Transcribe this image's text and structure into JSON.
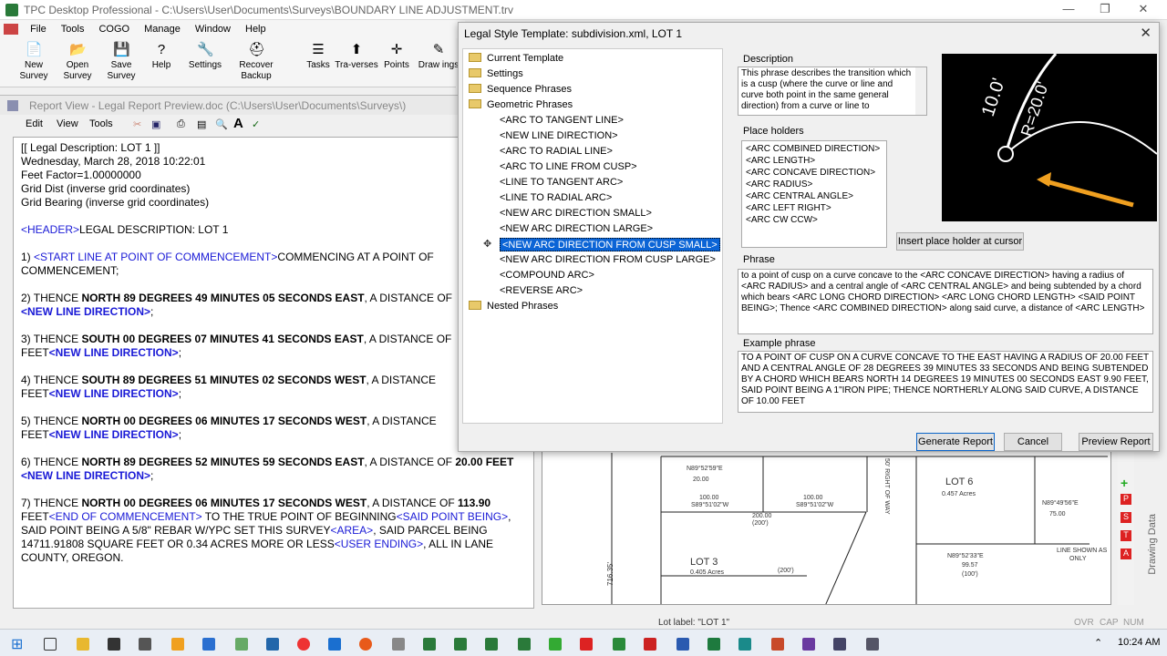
{
  "app": {
    "title": "TPC Desktop Professional - C:\\Users\\User\\Documents\\Surveys\\BOUNDARY LINE ADJUSTMENT.trv",
    "window_controls": [
      "—",
      "❐",
      "✕"
    ]
  },
  "menu": [
    "File",
    "Tools",
    "COGO",
    "Manage",
    "Window",
    "Help"
  ],
  "toolbar": [
    {
      "label": "New Survey",
      "icon": "new-survey-icon",
      "glyph": "📄"
    },
    {
      "label": "Open Survey",
      "icon": "open-survey-icon",
      "glyph": "📂"
    },
    {
      "label": "Save Survey",
      "icon": "save-survey-icon",
      "glyph": "💾"
    },
    {
      "label": "Help",
      "icon": "help-icon",
      "glyph": "?"
    },
    {
      "label": "Settings",
      "icon": "settings-icon",
      "glyph": "🔧"
    },
    {
      "label": "Recover Backup",
      "icon": "recover-backup-icon",
      "glyph": "⛑"
    },
    {
      "label": "Tasks",
      "icon": "tasks-icon",
      "glyph": "☰"
    },
    {
      "label": "Tra-verses",
      "icon": "traverses-icon",
      "glyph": "⬆"
    },
    {
      "label": "Points",
      "icon": "points-icon",
      "glyph": "✛"
    },
    {
      "label": "Draw ings",
      "icon": "drawings-icon",
      "glyph": "✎"
    }
  ],
  "report_view": {
    "title": "Report View - Legal Report Preview.doc (C:\\Users\\User\\Documents\\Surveys\\)",
    "menu": [
      "Edit",
      "View",
      "Tools"
    ],
    "lines": [
      [
        {
          "t": "[[ Legal Description: LOT 1 ]]"
        }
      ],
      [
        {
          "t": "Wednesday, March 28, 2018 10:22:01"
        }
      ],
      [
        {
          "t": "Feet  Factor=1.00000000"
        }
      ],
      [
        {
          "t": "Grid Dist (inverse grid coordinates)"
        }
      ],
      [
        {
          "t": "Grid Bearing (inverse grid coordinates)"
        }
      ],
      [
        {
          "t": ""
        }
      ],
      [
        {
          "t": "<HEADER>",
          "c": "b"
        },
        {
          "t": "LEGAL DESCRIPTION: LOT 1"
        }
      ],
      [
        {
          "t": ""
        }
      ],
      [
        {
          "t": "1) "
        },
        {
          "t": "<START LINE AT POINT OF COMMENCEMENT>",
          "c": "b"
        },
        {
          "t": "COMMENCING AT A POINT OF"
        }
      ],
      [
        {
          "t": "COMMENCEMENT;"
        }
      ],
      [
        {
          "t": ""
        }
      ],
      [
        {
          "t": "2) THENCE "
        },
        {
          "t": "NORTH  89 DEGREES  49 MINUTES  05 SECONDS  EAST",
          "c": "k"
        },
        {
          "t": ", A DISTANCE OF"
        }
      ],
      [
        {
          "t": "<NEW LINE DIRECTION>",
          "c": "b k"
        },
        {
          "t": ";"
        }
      ],
      [
        {
          "t": ""
        }
      ],
      [
        {
          "t": "3) THENCE "
        },
        {
          "t": "SOUTH  00 DEGREES  07 MINUTES  41 SECONDS  EAST",
          "c": "k"
        },
        {
          "t": ", A DISTANCE OF"
        }
      ],
      [
        {
          "t": "FEET"
        },
        {
          "t": "<NEW LINE DIRECTION>",
          "c": "b k"
        },
        {
          "t": ";"
        }
      ],
      [
        {
          "t": ""
        }
      ],
      [
        {
          "t": "4) THENCE "
        },
        {
          "t": "SOUTH  89 DEGREES  51 MINUTES  02 SECONDS  WEST",
          "c": "k"
        },
        {
          "t": ", A DISTANCE"
        }
      ],
      [
        {
          "t": "FEET"
        },
        {
          "t": "<NEW LINE DIRECTION>",
          "c": "b k"
        },
        {
          "t": ";"
        }
      ],
      [
        {
          "t": ""
        }
      ],
      [
        {
          "t": "5) THENCE "
        },
        {
          "t": "NORTH  00 DEGREES  06 MINUTES  17 SECONDS  WEST",
          "c": "k"
        },
        {
          "t": ", A DISTANCE"
        }
      ],
      [
        {
          "t": "FEET"
        },
        {
          "t": "<NEW LINE DIRECTION>",
          "c": "b k"
        },
        {
          "t": ";"
        }
      ],
      [
        {
          "t": ""
        }
      ],
      [
        {
          "t": "6) THENCE "
        },
        {
          "t": "NORTH  89 DEGREES  52 MINUTES  59 SECONDS  EAST",
          "c": "k"
        },
        {
          "t": ", A DISTANCE OF "
        },
        {
          "t": "20.00 FEET",
          "c": "k"
        }
      ],
      [
        {
          "t": "<NEW LINE DIRECTION>",
          "c": "b k"
        },
        {
          "t": ";"
        }
      ],
      [
        {
          "t": ""
        }
      ],
      [
        {
          "t": "7) THENCE "
        },
        {
          "t": "NORTH  00 DEGREES  06 MINUTES  17 SECONDS  WEST",
          "c": "k"
        },
        {
          "t": ", A DISTANCE OF "
        },
        {
          "t": "113.90",
          "c": "k"
        }
      ],
      [
        {
          "t": "FEET"
        },
        {
          "t": "<END OF COMMENCEMENT>",
          "c": "b"
        },
        {
          "t": " TO THE TRUE POINT OF BEGINNING"
        },
        {
          "t": "<SAID POINT BEING>",
          "c": "b"
        },
        {
          "t": ","
        }
      ],
      [
        {
          "t": "SAID POINT BEING A 5/8\" REBAR W/YPC SET THIS SURVEY"
        },
        {
          "t": "<AREA>",
          "c": "b"
        },
        {
          "t": ", SAID PARCEL BEING"
        }
      ],
      [
        {
          "t": "14711.91808 SQUARE FEET OR 0.34 ACRES MORE OR LESS"
        },
        {
          "t": "<USER ENDING>",
          "c": "b"
        },
        {
          "t": ", ALL IN LANE"
        }
      ],
      [
        {
          "t": "COUNTY, OREGON."
        }
      ]
    ]
  },
  "dialog": {
    "title": "Legal Style Template: subdivision.xml, LOT 1",
    "close": "✕",
    "tree": {
      "folders_top": [
        "Current Template",
        "Settings",
        "Sequence Phrases",
        "Geometric Phrases"
      ],
      "phrases": [
        "<ARC TO TANGENT LINE>",
        "<NEW LINE DIRECTION>",
        "<ARC TO RADIAL LINE>",
        "<ARC TO LINE FROM CUSP>",
        "<LINE TO TANGENT ARC>",
        "<LINE TO RADIAL ARC>",
        "<NEW ARC DIRECTION SMALL>",
        "<NEW ARC DIRECTION LARGE>",
        "<NEW ARC DIRECTION FROM CUSP SMALL>",
        "<NEW ARC DIRECTION FROM CUSP LARGE>",
        "<COMPOUND ARC>",
        "<REVERSE ARC>"
      ],
      "selected_index": 8,
      "folders_bottom": [
        "Nested Phrases"
      ]
    },
    "description": {
      "label": "Description",
      "text": "This phrase describes the transition which is a cusp (where the curve or line and curve both point in the same general direction) from a curve or line to"
    },
    "placeholders": {
      "label": "Place holders",
      "items": [
        "<ARC COMBINED DIRECTION>",
        "<ARC LENGTH>",
        "<ARC CONCAVE DIRECTION>",
        "<ARC RADIUS>",
        "<ARC CENTRAL ANGLE>",
        "<ARC LEFT RIGHT>",
        "<ARC CW CCW>"
      ]
    },
    "insert_button": "Insert place holder at cursor",
    "phrase": {
      "label": "Phrase",
      "text": "to a point of cusp on a curve concave to the <ARC CONCAVE DIRECTION> having a radius of <ARC RADIUS> and a central angle of <ARC CENTRAL ANGLE> and being subtended by a chord which bears <ARC LONG CHORD DIRECTION> <ARC LONG CHORD LENGTH> <SAID POINT BEING>; Thence <ARC COMBINED DIRECTION> along said curve, a distance of <ARC LENGTH>"
    },
    "example": {
      "label": "Example phrase",
      "text": "TO A POINT OF CUSP ON A CURVE CONCAVE TO THE EAST HAVING A RADIUS OF 20.00 FEET AND A CENTRAL ANGLE OF 28 DEGREES 39 MINUTES 33 SECONDS AND BEING SUBTENDED BY A CHORD WHICH BEARS NORTH  14 DEGREES  19 MINUTES  00 SECONDS  EAST 9.90 FEET, SAID POINT BEING A 1\"IRON PIPE; THENCE NORTHERLY ALONG SAID CURVE, A DISTANCE OF 10.00 FEET"
    },
    "preview_labels": {
      "distance": "10.0'",
      "radius": "R=20.0'"
    },
    "buttons": {
      "generate": "Generate Report",
      "cancel": "Cancel",
      "preview": "Preview Report"
    }
  },
  "drawing": {
    "labels": [
      "N89°52'59\"E",
      "20.00",
      "S89°51'02\"W",
      "100.00",
      "S89°51'02\"W",
      "200.00",
      "(200')",
      "100.00",
      "LOT 6",
      "0.457 Acres",
      "N89°49'56\"E",
      "75.00",
      "N89°52'33\"E",
      "99.57",
      "(100')",
      "LOT 3",
      "0.405 Acres",
      "(200')",
      "LINE SHOWN AS",
      "ONLY",
      "50' RIGHT OF WAY",
      "716.35'"
    ],
    "side_tab": "Drawing Data"
  },
  "status": {
    "text": "Lot label: \"LOT 1\"",
    "indicators": [
      "OVR",
      "CAP",
      "NUM"
    ]
  },
  "taskbar": {
    "time": "10:24 AM"
  }
}
